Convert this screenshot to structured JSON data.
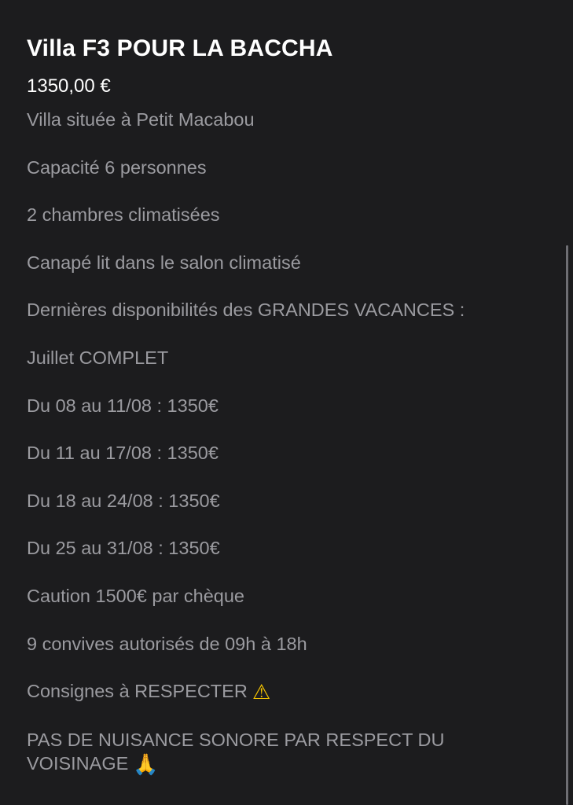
{
  "listing": {
    "title": "Villa F3 POUR LA BACCHA",
    "price": "1350,00 €",
    "description": [
      "Villa située à Petit Macabou",
      "Capacité 6 personnes",
      "2 chambres climatisées",
      "Canapé lit dans le salon climatisé",
      "Dernières disponibilités des GRANDES VACANCES :",
      "Juillet COMPLET",
      "Du 08 au 11/08 : 1350€",
      "Du 11 au 17/08 : 1350€",
      "Du 18 au 24/08 : 1350€",
      "Du 25 au 31/08 : 1350€",
      "Caution 1500€ par chèque",
      "9 convives autorisés de 09h à 18h",
      "Consignes à RESPECTER",
      "PAS DE NUISANCE SONORE PAR RESPECT DU VOISINAGE"
    ],
    "icons": {
      "warning": "⚠",
      "pray": "🙏"
    }
  },
  "colors": {
    "background": "#1c1c1e",
    "title_text": "#ffffff",
    "body_text": "#9b9ba0",
    "scrollbar": "#6e6e73"
  }
}
